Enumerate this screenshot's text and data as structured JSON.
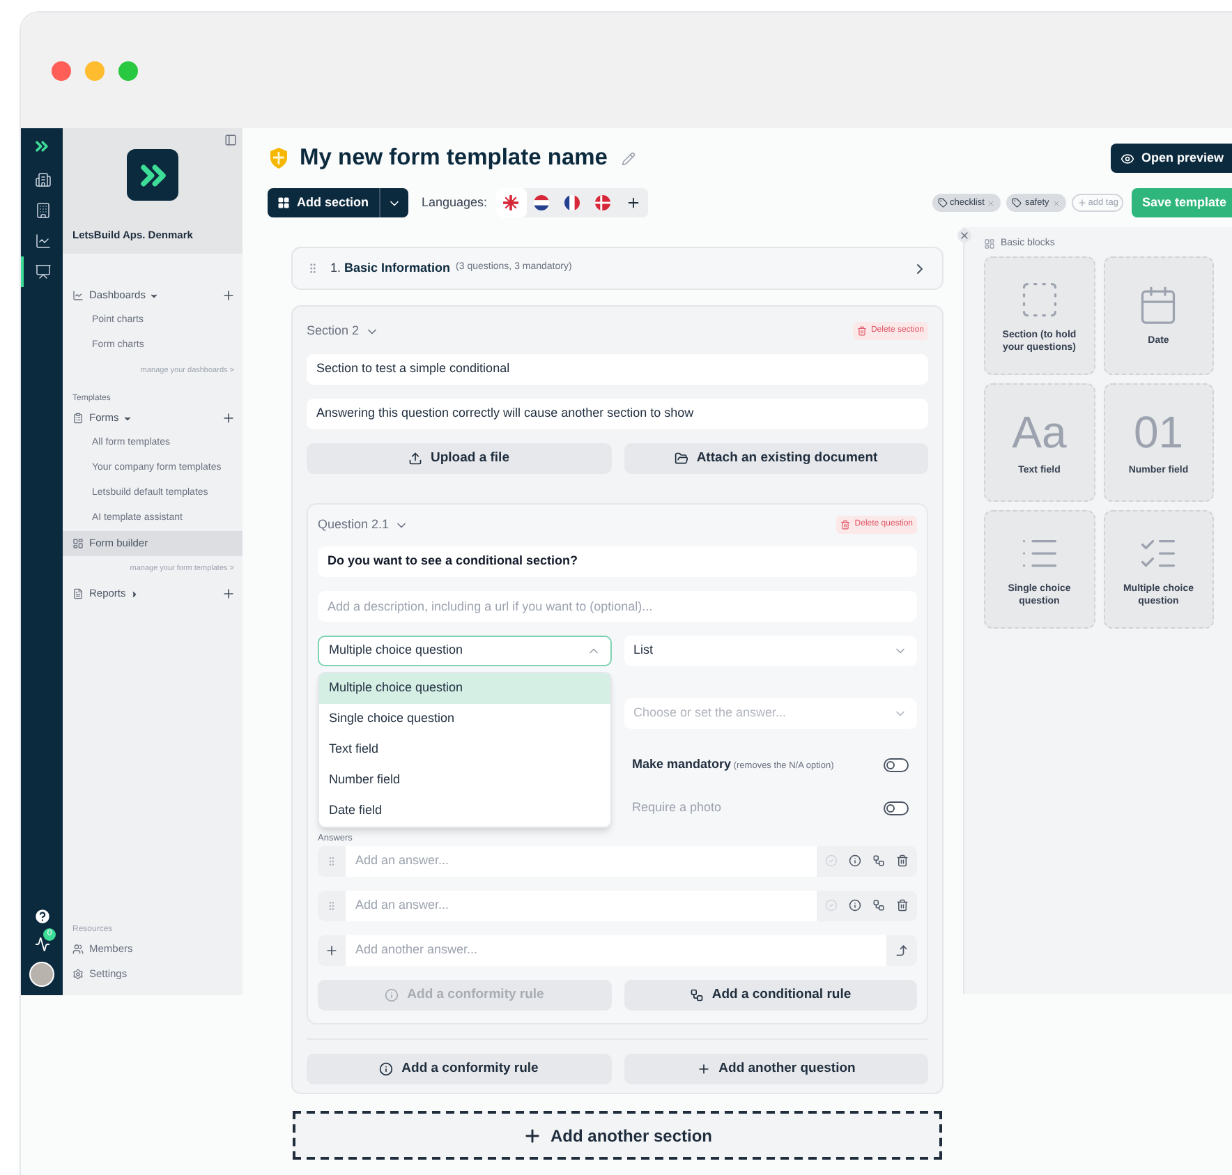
{
  "rail": {
    "items": [
      {
        "selected": false
      },
      {
        "selected": false
      },
      {
        "selected": false
      },
      {
        "selected": true
      }
    ],
    "notification_count": "0"
  },
  "sidebar": {
    "company": "LetsBuild Aps. Denmark",
    "nav": [
      {
        "kind": "group",
        "label": "Dashboards",
        "expanded": true
      },
      {
        "kind": "subitem",
        "label": "Point charts",
        "selected": false
      },
      {
        "kind": "subitem",
        "label": "Form charts",
        "selected": false
      },
      {
        "kind": "link",
        "label": "manage your dashboards >"
      },
      {
        "kind": "heading",
        "label": "Templates"
      },
      {
        "kind": "group",
        "label": "Forms",
        "expanded": true
      },
      {
        "kind": "subitem",
        "label": "All form templates",
        "selected": false
      },
      {
        "kind": "subitem",
        "label": "Your company form templates",
        "selected": false
      },
      {
        "kind": "subitem",
        "label": "Letsbuild default templates",
        "selected": false
      },
      {
        "kind": "subitem",
        "label": "AI template assistant",
        "selected": false
      },
      {
        "kind": "item",
        "label": "Form builder",
        "selected": true
      },
      {
        "kind": "link",
        "label": "manage your form templates >"
      },
      {
        "kind": "group",
        "label": "Reports",
        "expanded": false
      }
    ],
    "resources": {
      "heading": "Resources",
      "items": [
        {
          "label": "Members"
        },
        {
          "label": "Settings"
        }
      ]
    }
  },
  "header": {
    "title": "My new form template name",
    "open_preview": "Open preview",
    "add_section": "Add section",
    "languages_label": "Languages:",
    "languages": [
      {
        "kind": "uk",
        "selected": true
      },
      {
        "kind": "nl",
        "selected": false
      },
      {
        "kind": "fr",
        "selected": false
      },
      {
        "kind": "dk",
        "selected": false
      }
    ],
    "tags": [
      {
        "label": "checklist"
      },
      {
        "label": "safety"
      }
    ],
    "add_tag": "add tag",
    "save": "Save template"
  },
  "sections": [
    {
      "number": "1.",
      "title": "Basic Information",
      "summary": "(3 questions, 3 mandatory)",
      "expanded": false
    },
    {
      "label": "Section 2",
      "expanded": true,
      "delete": "Delete section",
      "name": "Section to test a simple conditional",
      "description": "Answering this question correctly will cause another section to show",
      "upload": "Upload a file",
      "attach": "Attach an existing document",
      "question": {
        "label": "Question 2.1",
        "expanded": true,
        "delete": "Delete question",
        "title": "Do you want to see a conditional section?",
        "description_placeholder": "Add a description, including a url if you want to (optional)...",
        "type_select": {
          "value": "Multiple choice question",
          "open": true,
          "options": [
            {
              "label": "Multiple choice question",
              "selected": true
            },
            {
              "label": "Single choice question",
              "selected": false
            },
            {
              "label": "Text field",
              "selected": false
            },
            {
              "label": "Number field",
              "selected": false
            },
            {
              "label": "Date field",
              "selected": false
            }
          ]
        },
        "display_select": {
          "value": "List"
        },
        "answer_select": {
          "placeholder": "Choose or set the answer...",
          "disabled": true
        },
        "toggles": [
          {
            "label": "Make mandatory",
            "note": "(removes the N/A option)",
            "on": false,
            "disabled": false
          },
          {
            "label": "Require a photo",
            "on": false,
            "disabled": true
          }
        ],
        "answers_label": "Answers",
        "answers": [
          {
            "placeholder": "Add an answer..."
          },
          {
            "placeholder": "Add an answer..."
          }
        ],
        "new_answer_placeholder": "Add another answer...",
        "rule_buttons": [
          {
            "kind": "conformity",
            "label": "Add a conformity rule",
            "disabled": true
          },
          {
            "kind": "conditional",
            "label": "Add a conditional rule",
            "disabled": false
          }
        ]
      },
      "buttons": [
        {
          "kind": "conformity",
          "label": "Add a conformity rule"
        },
        {
          "kind": "add",
          "label": "Add another question"
        }
      ]
    }
  ],
  "add_another_section": "Add another section",
  "blocks_panel": {
    "title": "Basic blocks",
    "blocks": [
      {
        "kind": "section",
        "label": "Section (to hold your questions)"
      },
      {
        "kind": "date",
        "label": "Date"
      },
      {
        "kind": "text",
        "glyph": "Aa",
        "label": "Text field"
      },
      {
        "kind": "number",
        "glyph": "01",
        "label": "Number field"
      },
      {
        "kind": "single",
        "label": "Single choice question"
      },
      {
        "kind": "multiple",
        "label": "Multiple choice question"
      }
    ]
  }
}
